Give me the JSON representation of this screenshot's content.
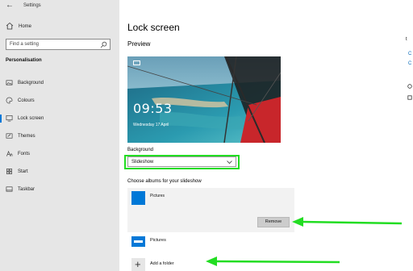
{
  "window": {
    "title": "Settings"
  },
  "sidebar": {
    "home_label": "Home",
    "search_placeholder": "Find a setting",
    "section_title": "Personalisation",
    "items": [
      {
        "label": "Background",
        "icon": "image-icon"
      },
      {
        "label": "Colours",
        "icon": "palette-icon"
      },
      {
        "label": "Lock screen",
        "icon": "lock-screen-icon",
        "active": true
      },
      {
        "label": "Themes",
        "icon": "brush-icon"
      },
      {
        "label": "Fonts",
        "icon": "font-icon"
      },
      {
        "label": "Start",
        "icon": "start-icon"
      },
      {
        "label": "Taskbar",
        "icon": "taskbar-icon"
      }
    ]
  },
  "main": {
    "page_title": "Lock screen",
    "preview_label": "Preview",
    "preview_time": "09:53",
    "preview_date": "Wednesday 17 April",
    "background_label": "Background",
    "background_value": "Slideshow",
    "albums_label": "Choose albums for your slideshow",
    "albums": [
      {
        "name": "Pictures",
        "selected": true,
        "remove_label": "Remove"
      },
      {
        "name": "Pictures",
        "selected": false
      }
    ],
    "add_folder_label": "Add a folder"
  },
  "right_fragments": [
    "C",
    "C"
  ],
  "colors": {
    "accent": "#0078d7",
    "highlight_annotation": "#22dd22",
    "sidebar_bg": "#e6e6e6",
    "link": "#0067b8"
  }
}
